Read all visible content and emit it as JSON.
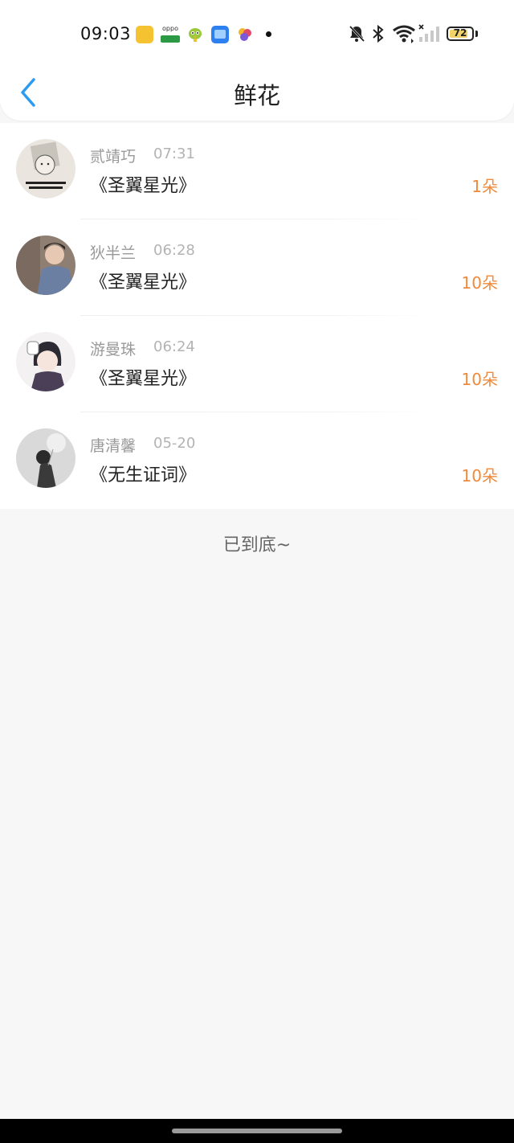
{
  "status_bar": {
    "time": "09:03",
    "app_icons": [
      "notes-icon",
      "oppo-icon",
      "bird-icon",
      "files-icon",
      "game-icon"
    ],
    "system_icons": [
      "bell-muted-icon",
      "bluetooth-icon",
      "wifi-icon",
      "cellular-signal-icon"
    ],
    "battery_level": "72"
  },
  "header": {
    "back_icon": "chevron-left-icon",
    "title": "鲜花"
  },
  "records": [
    {
      "name": "贰靖巧",
      "time": "07:31",
      "book": "《圣翼星光》",
      "count": "1朵"
    },
    {
      "name": "狄半兰",
      "time": "06:28",
      "book": "《圣翼星光》",
      "count": "10朵"
    },
    {
      "name": "游曼珠",
      "time": "06:24",
      "book": "《圣翼星光》",
      "count": "10朵"
    },
    {
      "name": "唐清馨",
      "time": "05-20",
      "book": "《无生证词》",
      "count": "10朵"
    }
  ],
  "footer": {
    "end_text": "已到底~"
  },
  "colors": {
    "accent_back": "#2d9cf0",
    "count_orange": "#ef8a3c",
    "page_bg": "#f8f7f8"
  }
}
